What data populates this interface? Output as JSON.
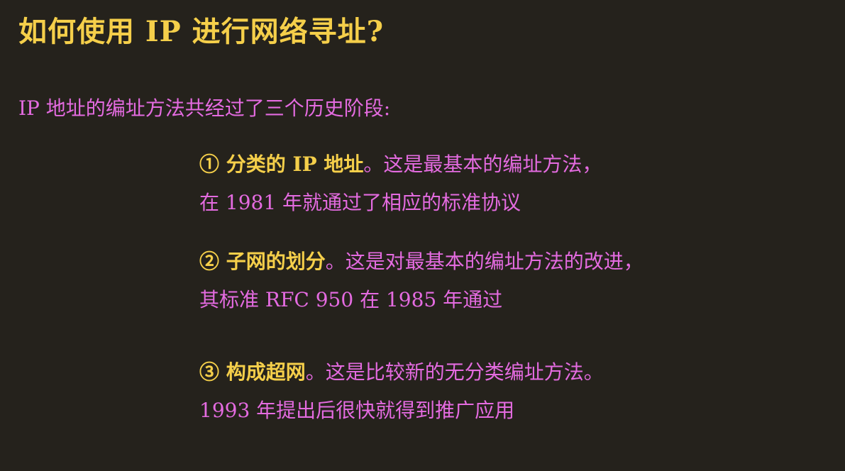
{
  "slide": {
    "title": "如何使用 IP 进行网络寻址?",
    "intro": "IP 地址的编址方法共经过了三个历史阶段:",
    "stages": [
      {
        "heading": "① 分类的 IP 地址",
        "desc": "。这是最基本的编址方法，",
        "detail": "在 1981 年就通过了相应的标准协议"
      },
      {
        "heading": "② 子网的划分",
        "desc": "。这是对最基本的编址方法的改进，",
        "detail": "其标准 RFC 950 在 1985 年通过"
      },
      {
        "heading": "③ 构成超网",
        "desc": "。这是比较新的无分类编址方法。",
        "detail": "1993 年提出后很快就得到推广应用"
      }
    ]
  },
  "colors": {
    "background": "#25221c",
    "title": "#f5cf4a",
    "body_text": "#e46be0",
    "heading": "#f5cf4a"
  }
}
